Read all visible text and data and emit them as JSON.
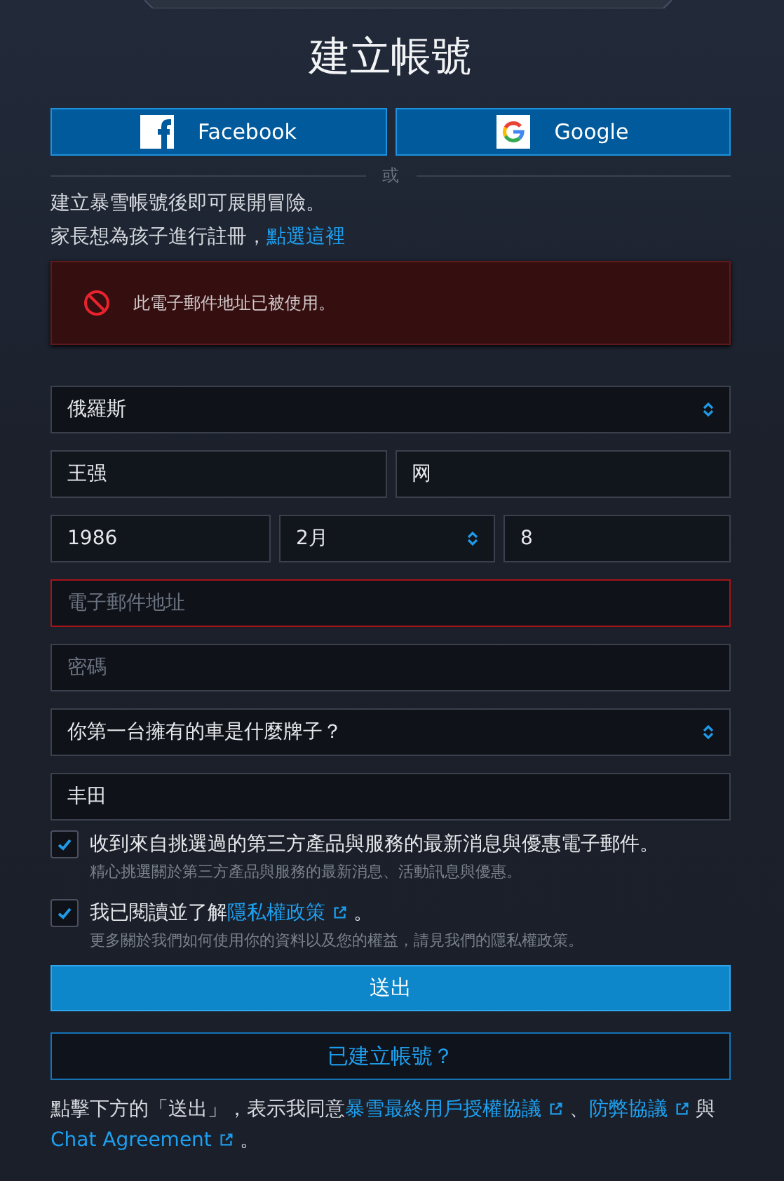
{
  "title": "建立帳號",
  "social_buttons": [
    {
      "kind": "facebook",
      "label": "Facebook"
    },
    {
      "kind": "google",
      "label": "Google"
    }
  ],
  "divider": "或",
  "intro": "建立暴雪帳號後即可展開冒險。",
  "parent_prompt": {
    "text": "家長想為孩子進行註冊，",
    "link": "點選這裡"
  },
  "error": {
    "message": "此電子郵件地址已被使用。"
  },
  "country": {
    "value": "俄羅斯"
  },
  "first_name": {
    "value": "王强"
  },
  "last_name": {
    "value": "网"
  },
  "birth": {
    "year": "1986",
    "month": "2月",
    "day": "8"
  },
  "email": {
    "placeholder": "電子郵件地址",
    "invalid": true
  },
  "password": {
    "placeholder": "密碼"
  },
  "security_question": {
    "value": "你第一台擁有的車是什麼牌子？"
  },
  "security_answer": {
    "value": "丰田"
  },
  "checkboxes": [
    {
      "checked": true,
      "text": "收到來自挑選過的第三方產品與服務的最新消息與優惠電子郵件。",
      "note": "精心挑選關於第三方產品與服務的最新消息、活動訊息與優惠。"
    },
    {
      "checked": true,
      "text": "我已閱讀並了解",
      "link": "隱私權政策",
      "after": "。",
      "note": "更多關於我們如何使用你的資料以及您的權益，請見我們的隱私權政策。"
    }
  ],
  "submit": "送出",
  "login": "已建立帳號？",
  "terms": [
    {
      "kind": "text",
      "text": "點擊下方的「送出」，表示我同意"
    },
    {
      "kind": "link",
      "text": "暴雪最終用戶授權協議"
    },
    {
      "kind": "text",
      "text": "、"
    },
    {
      "kind": "link",
      "text": "防弊協議"
    },
    {
      "kind": "text",
      "text": "與"
    },
    {
      "kind": "link",
      "text": "Chat Agreement"
    },
    {
      "kind": "text",
      "text": "。"
    }
  ]
}
